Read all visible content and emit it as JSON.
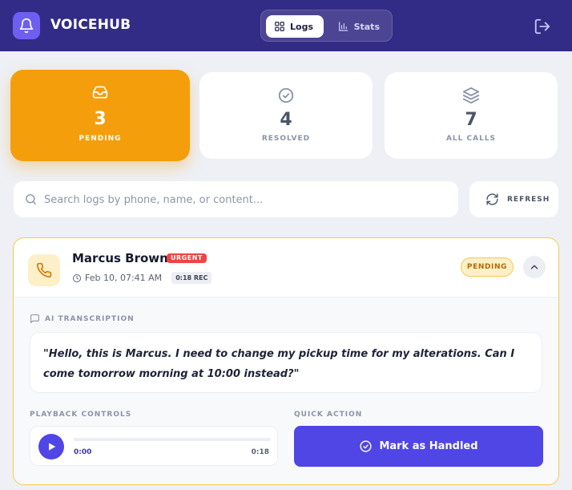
{
  "app": {
    "name": "VOICEHUB"
  },
  "nav": {
    "tabs": [
      {
        "label": "Logs",
        "icon": "grid-icon"
      },
      {
        "label": "Stats",
        "icon": "bar-chart-icon"
      }
    ],
    "active_tab": "Logs"
  },
  "stats": {
    "pending": {
      "count": "3",
      "label": "PENDING",
      "icon": "inbox-icon"
    },
    "resolved": {
      "count": "4",
      "label": "RESOLVED",
      "icon": "check-circle-icon"
    },
    "all_calls": {
      "count": "7",
      "label": "ALL CALLS",
      "icon": "layers-icon"
    }
  },
  "search": {
    "placeholder": "Search logs by phone, name, or content...",
    "value": ""
  },
  "refresh": {
    "label": "REFRESH"
  },
  "log": {
    "caller": "Marcus Brown",
    "badge": "URGENT",
    "timestamp": "Feb 10, 07:41 AM",
    "duration_tag": "0:18 REC",
    "status": "PENDING",
    "transcription_label": "AI TRANSCRIPTION",
    "transcription": "\"Hello, this is Marcus. I need to change my pickup time for my alterations. Can I come tomorrow morning at 10:00 instead?\"",
    "playback_label": "PLAYBACK CONTROLS",
    "current_time": "0:00",
    "total_time": "0:18",
    "progress": 0,
    "quick_action_label": "QUICK ACTION",
    "action_button": "Mark as Handled"
  },
  "colors": {
    "header": "#332c86",
    "accent": "#4f46e5",
    "pending": "#f59e0b",
    "urgent": "#ef4444"
  }
}
